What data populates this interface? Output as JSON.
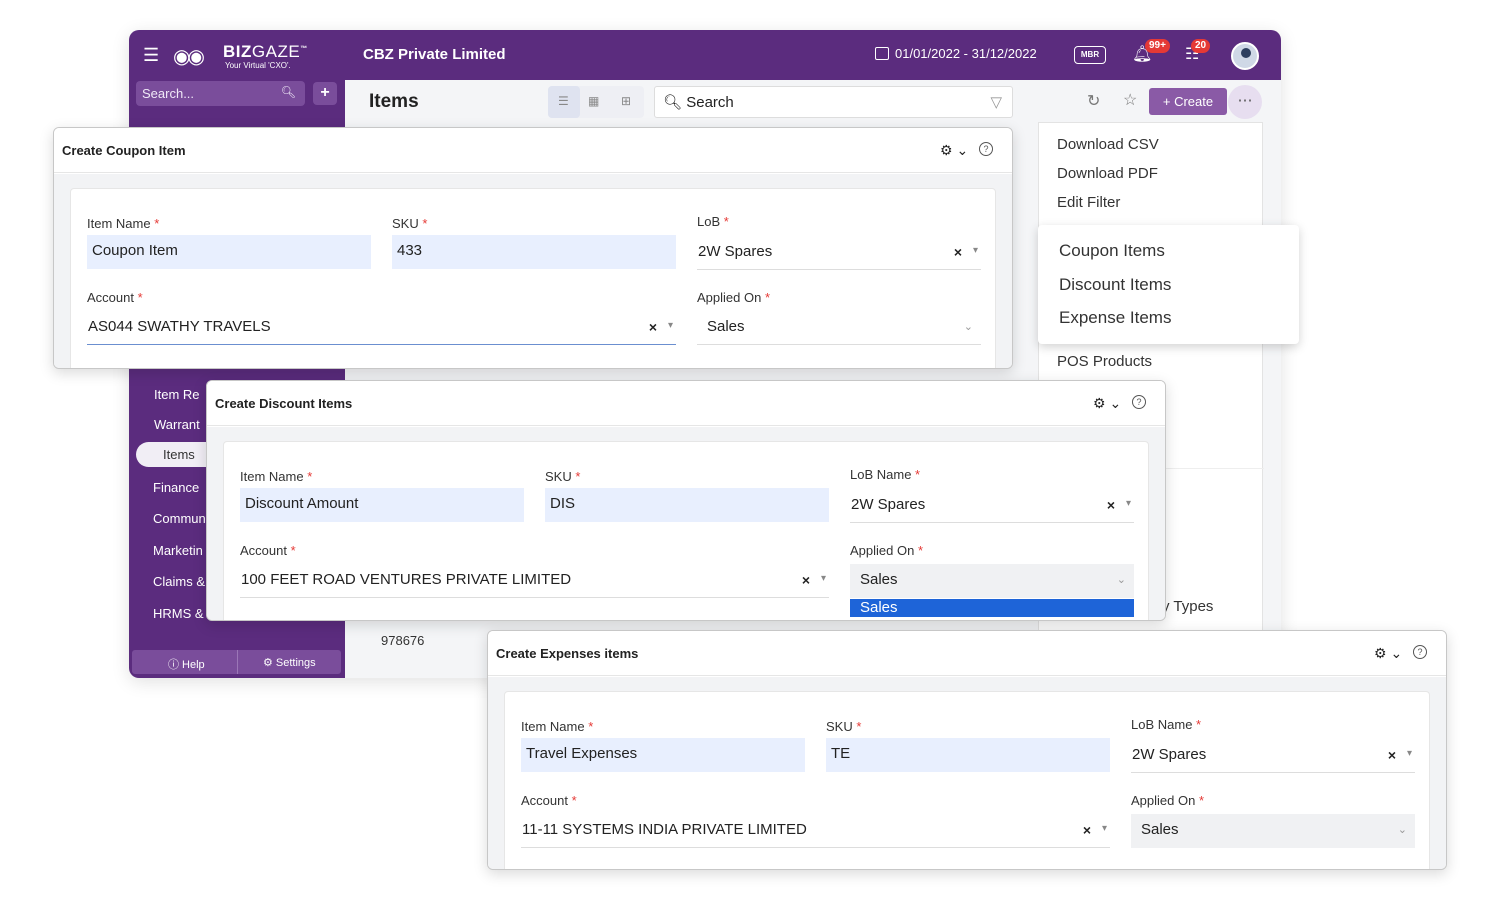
{
  "header": {
    "brand": "BIZ",
    "brand2": "GAZE",
    "tm": "™",
    "tagline": "Your Virtual 'CXO'.",
    "company": "CBZ Private Limited",
    "date_range": "01/01/2022 - 31/12/2022",
    "mbr": "MBR",
    "notif_badge": "99+",
    "task_badge": "20"
  },
  "sidebar": {
    "search_placeholder": "Search...",
    "items": [
      "Item Re",
      "Warrant"
    ],
    "active": "Items",
    "sections": [
      "Finance",
      "Commun",
      "Marketin",
      "Claims &",
      "HRMS &"
    ],
    "help": "ⓘ Help",
    "settings": "⚙ Settings"
  },
  "main": {
    "title": "Items",
    "search_placeholder": "Search",
    "create_label": "+ Create",
    "bg_value": "978676"
  },
  "more_menu": {
    "items": [
      "Download CSV",
      "Download PDF",
      "Edit Filter",
      "POS Products"
    ],
    "partial": "ry Types"
  },
  "create_submenu": {
    "items": [
      "Coupon Items",
      "Discount Items",
      "Expense Items"
    ]
  },
  "dialogs": {
    "coupon": {
      "title": "Create Coupon Item",
      "item_name_label": "Item Name",
      "item_name": "Coupon Item",
      "sku_label": "SKU",
      "sku": "433",
      "lob_label": "LoB",
      "lob": "2W Spares",
      "account_label": "Account",
      "account": "AS044 SWATHY TRAVELS",
      "applied_label": "Applied On",
      "applied": "Sales"
    },
    "discount": {
      "title": "Create Discount Items",
      "item_name_label": "Item Name",
      "item_name": "Discount Amount",
      "sku_label": "SKU",
      "sku": "DIS",
      "lob_label": "LoB Name",
      "lob": "2W Spares",
      "account_label": "Account",
      "account": "100 FEET ROAD VENTURES PRIVATE LIMITED",
      "applied_label": "Applied On",
      "applied": "Sales",
      "option_selected": "Sales"
    },
    "expense": {
      "title": "Create Expenses items",
      "item_name_label": "Item Name",
      "item_name": "Travel Expenses",
      "sku_label": "SKU",
      "sku": "TE",
      "lob_label": "LoB Name",
      "lob": "2W Spares",
      "account_label": "Account",
      "account": "11-11 SYSTEMS INDIA PRIVATE LIMITED",
      "applied_label": "Applied On",
      "applied": "Sales"
    }
  },
  "colors": {
    "primary": "#5b2c7e",
    "input_bg": "#e8effe",
    "required": "#e53935",
    "highlight": "#1e64d8"
  }
}
